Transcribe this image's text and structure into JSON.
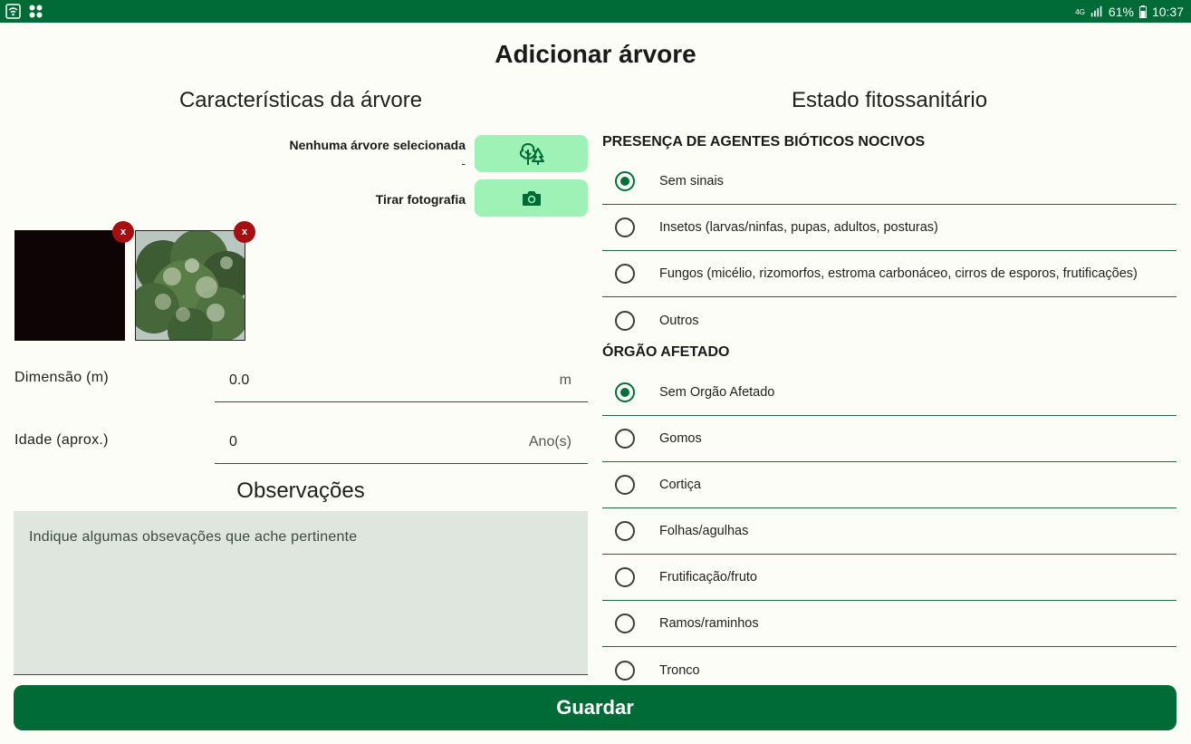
{
  "status_bar": {
    "battery": "61%",
    "time": "10:37",
    "network": "4G"
  },
  "page_title": "Adicionar árvore",
  "left": {
    "section_title": "Características da árvore",
    "tree_picker": {
      "label": "Nenhuma árvore selecionada",
      "sub": "-",
      "icon": "tree-icon"
    },
    "photo": {
      "label": "Tirar fotografia",
      "icon": "camera-icon"
    },
    "photos": [
      {
        "delete_label": "x"
      },
      {
        "delete_label": "x"
      }
    ],
    "dimension": {
      "label": "Dimensão (m)",
      "value": "0.0",
      "suffix": "m"
    },
    "age": {
      "label": "Idade (aprox.)",
      "value": "0",
      "suffix": "Ano(s)"
    },
    "observations": {
      "title": "Observações",
      "placeholder": "Indique algumas obsevações que ache pertinente"
    }
  },
  "right": {
    "section_title": "Estado fitossanitário",
    "biotic": {
      "header": "PRESENÇA DE AGENTES BIÓTICOS NOCIVOS",
      "options": [
        {
          "label": "Sem sinais",
          "checked": true
        },
        {
          "label": "Insetos (larvas/ninfas, pupas, adultos, posturas)",
          "checked": false
        },
        {
          "label": "Fungos (micélio, rizomorfos, estroma carbonáceo, cirros de esporos, frutificações)",
          "checked": false
        },
        {
          "label": "Outros",
          "checked": false
        }
      ]
    },
    "organ": {
      "header": "ÓRGÃO AFETADO",
      "options": [
        {
          "label": "Sem Orgão Afetado",
          "checked": true
        },
        {
          "label": "Gomos",
          "checked": false
        },
        {
          "label": "Cortiça",
          "checked": false
        },
        {
          "label": "Folhas/agulhas",
          "checked": false
        },
        {
          "label": "Frutificação/fruto",
          "checked": false
        },
        {
          "label": "Ramos/raminhos",
          "checked": false
        },
        {
          "label": "Tronco",
          "checked": false
        }
      ]
    }
  },
  "save_label": "Guardar",
  "colors": {
    "primary": "#006b36",
    "accent_light": "#9ef2b5",
    "delete": "#a40f12",
    "background": "#fbfdf6"
  }
}
